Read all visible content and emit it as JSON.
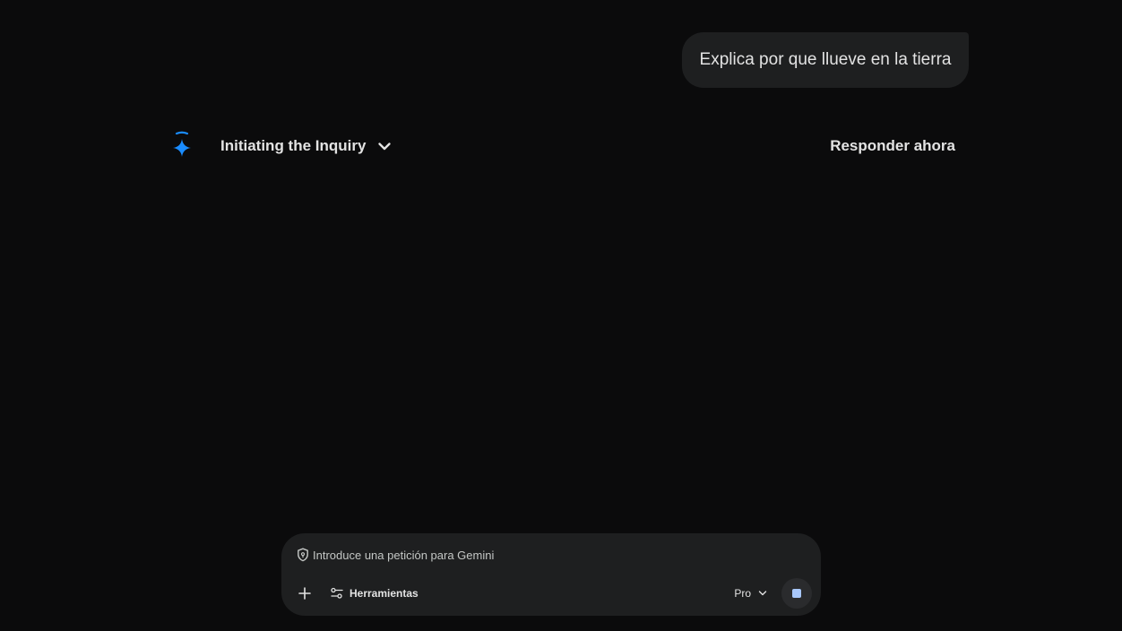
{
  "conversation": {
    "user_message": "Explica por que llueve en la tierra"
  },
  "response": {
    "thinking_title": "Initiating the Inquiry",
    "respond_now_label": "Responder ahora",
    "spark_icon": "gemini-spark-icon",
    "accent_color": "#1a8cff"
  },
  "composer": {
    "placeholder": "Introduce una petición para Gemini",
    "tools_label": "Herramientas",
    "model_label": "Pro",
    "stop_color": "#a8c7fa"
  }
}
